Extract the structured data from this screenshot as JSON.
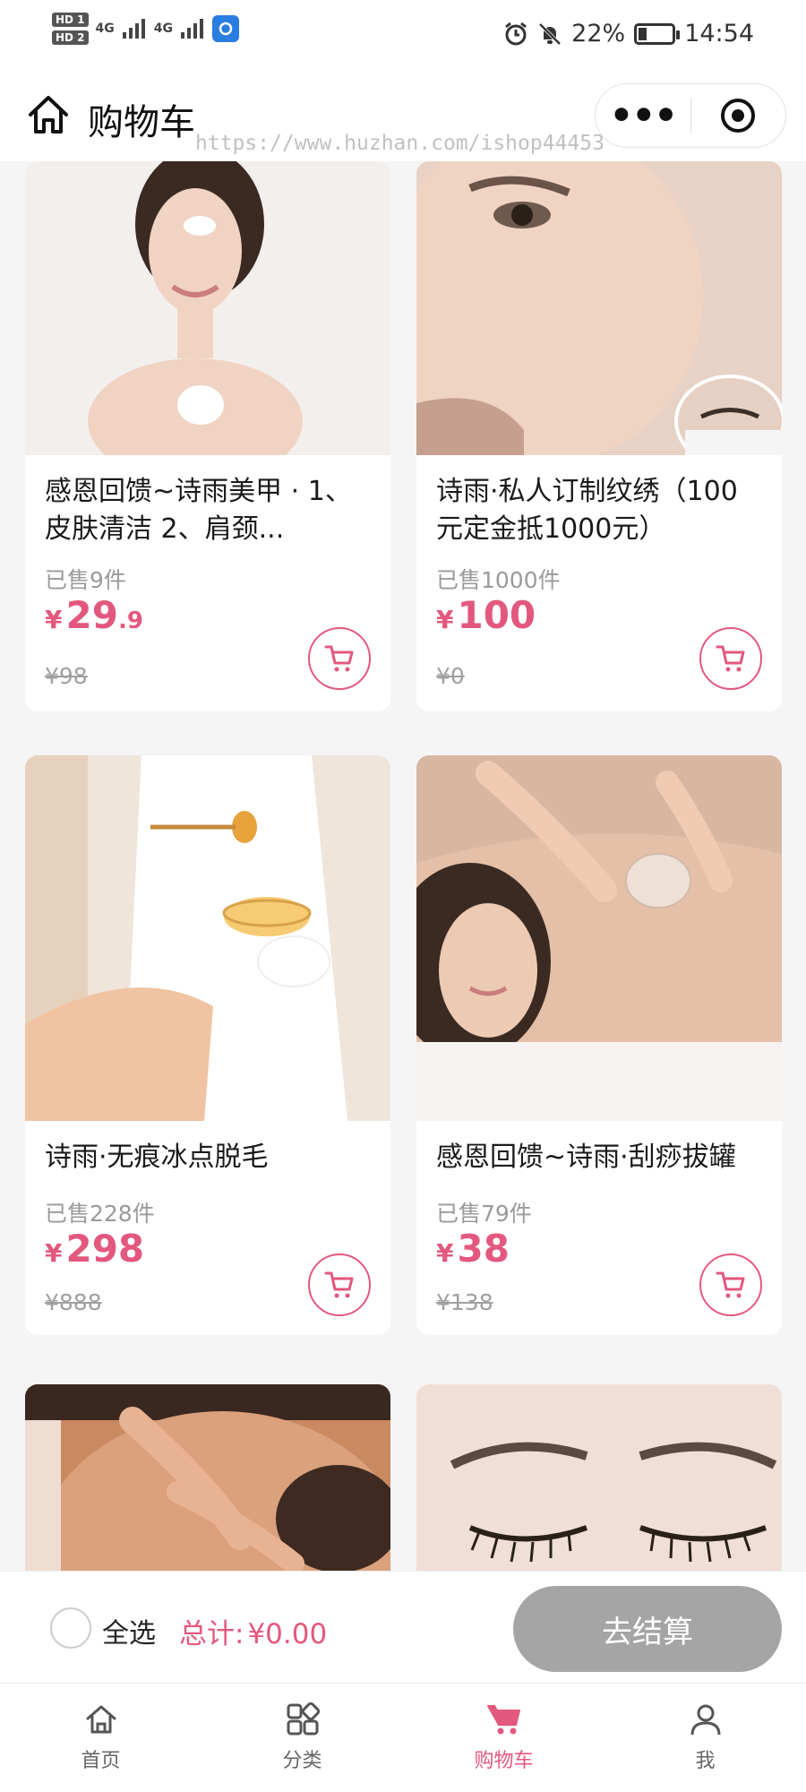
{
  "status_bar": {
    "hd1": "HD 1",
    "hd2": "HD 2",
    "signal1": "4G",
    "signal2": "4G",
    "battery_percent": "22%",
    "battery_level": 0.22,
    "time": "14:54"
  },
  "header": {
    "title": "购物车",
    "more_label": "•••",
    "watermark": "https://www.huzhan.com/ishop44453"
  },
  "products": [
    {
      "title": "感恩回馈~诗雨美甲 · 1、皮肤清洁 2、肩颈...",
      "sold": "已售9件",
      "currency": "¥",
      "price_int": "29",
      "price_dec": ".9",
      "original": "¥98"
    },
    {
      "title": "诗雨·私人订制纹绣（100元定金抵1000元）",
      "sold": "已售1000件",
      "currency": "¥",
      "price_int": "100",
      "price_dec": "",
      "original": "¥0"
    },
    {
      "title": "诗雨·无痕冰点脱毛",
      "sold": "已售228件",
      "currency": "¥",
      "price_int": "298",
      "price_dec": "",
      "original": "¥888"
    },
    {
      "title": "感恩回馈~诗雨·刮痧拔罐",
      "sold": "已售79件",
      "currency": "¥",
      "price_int": "38",
      "price_dec": "",
      "original": "¥138"
    },
    {
      "title": "",
      "sold": "",
      "currency": "",
      "price_int": "",
      "price_dec": "",
      "original": ""
    },
    {
      "title": "",
      "sold": "",
      "currency": "",
      "price_int": "",
      "price_dec": "",
      "original": ""
    }
  ],
  "checkout": {
    "select_all": "全选",
    "total_label": "总计:",
    "total_amount": "¥0.00",
    "button": "去结算"
  },
  "tabbar": {
    "items": [
      {
        "label": "首页",
        "icon": "home-icon"
      },
      {
        "label": "分类",
        "icon": "category-icon"
      },
      {
        "label": "购物车",
        "icon": "cart-icon"
      },
      {
        "label": "我",
        "icon": "user-icon"
      }
    ],
    "active_index": 2
  },
  "colors": {
    "accent": "#e3587e",
    "checkout_button": "#a5a5a5",
    "page_bg": "#f5f5f5"
  }
}
